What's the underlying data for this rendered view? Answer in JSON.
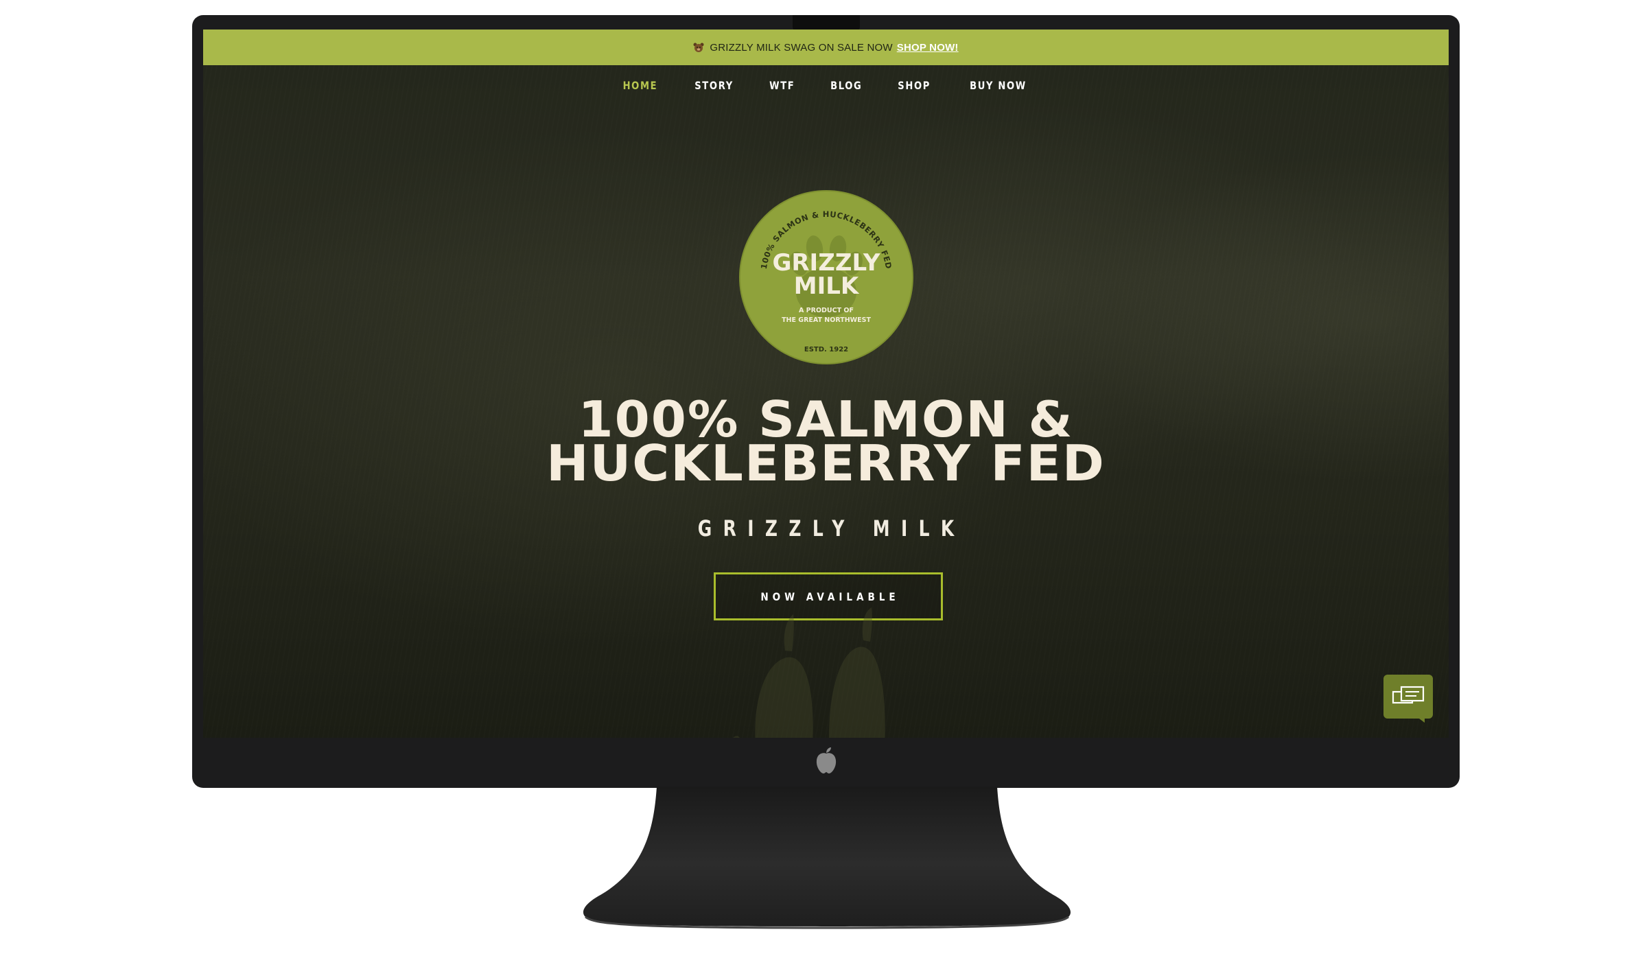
{
  "promo": {
    "text": "GRIZZLY MILK SWAG ON SALE NOW",
    "link": "SHOP NOW!"
  },
  "nav": {
    "items": [
      {
        "label": "HOME",
        "active": true
      },
      {
        "label": "STORY"
      },
      {
        "label": "WTF"
      },
      {
        "label": "BLOG"
      },
      {
        "label": "SHOP"
      },
      {
        "label": "BUY NOW"
      }
    ]
  },
  "badge": {
    "arc_text": "100% SALMON & HUCKLEBERRY FED",
    "title_line1": "GRIZZLY",
    "title_line2": "MILK",
    "tagline_line1": "A PRODUCT OF",
    "tagline_line2": "THE GREAT NORTHWEST",
    "established": "ESTD. 1922"
  },
  "hero": {
    "headline_line1": "100% SALMON &",
    "headline_line2": "HUCKLEBERRY FED",
    "subhead": "GRIZZLY MILK",
    "cta_label": "NOW AVAILABLE"
  },
  "colors": {
    "accent": "#a9b94a",
    "cta_border": "#a9bd2c",
    "nav_active": "#b7c64f",
    "headline": "#f5ecdc",
    "badge_fill": "#8fa23b",
    "chat_fill": "#6f7f2a"
  },
  "icons": {
    "promo": "bear-icon",
    "chat": "chat-icon",
    "chin": "apple-logo-icon"
  }
}
